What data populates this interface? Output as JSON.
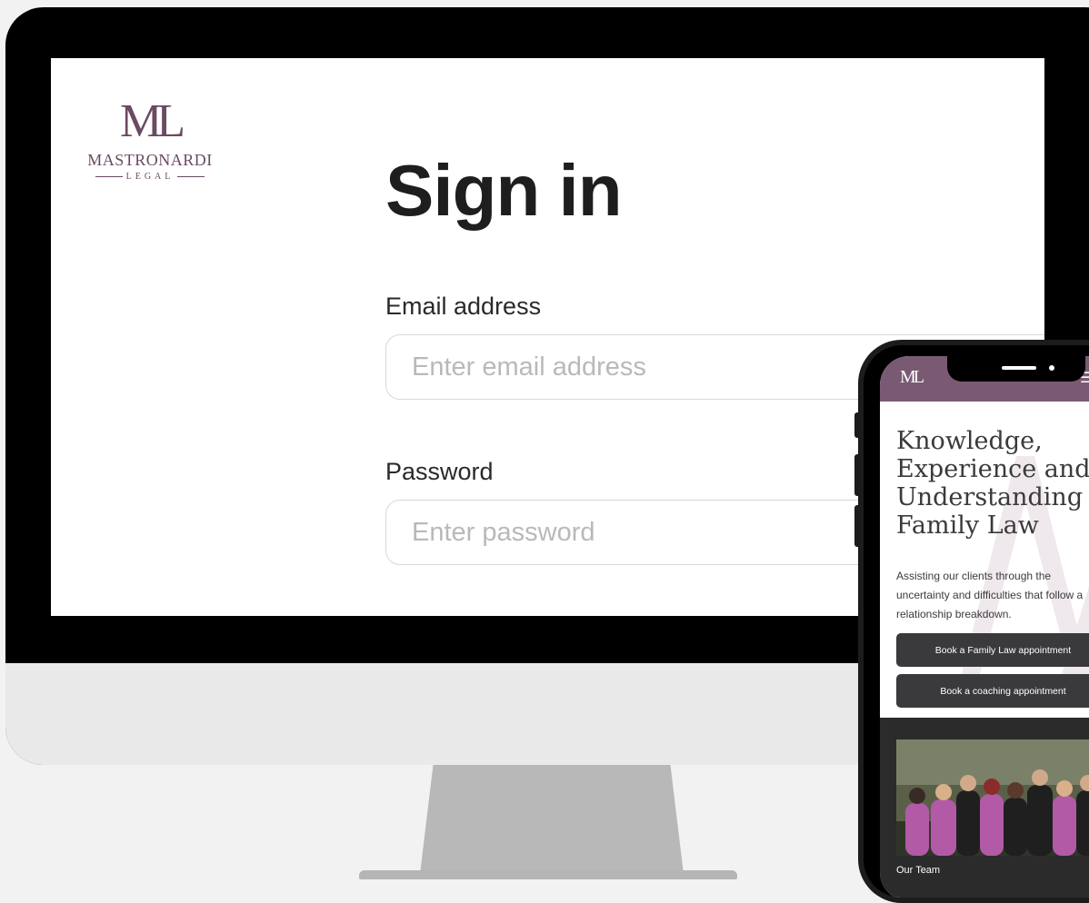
{
  "logo": {
    "mark": "ML",
    "name": "MASTRONARDI",
    "sub": "LEGAL"
  },
  "signin": {
    "title": "Sign in",
    "email_label": "Email address",
    "email_placeholder": "Enter email address",
    "password_label": "Password",
    "password_placeholder": "Enter password"
  },
  "phone": {
    "logo_mark": "ML",
    "menu_icon": "hamburger-menu-icon",
    "hero_title": "Knowledge, Experience and Understanding in Family Law",
    "hero_text": "Assisting our clients through the uncertainty and difficulties that follow a relationship breakdown.",
    "btn_family": "Book a Family Law appointment",
    "btn_coaching": "Book a coaching appointment",
    "team_caption": "Our Team"
  },
  "colors": {
    "brand": "#6b4a63",
    "phone_header": "#7a5a72",
    "button": "#3a3a3c",
    "team_shirt": "#b25aa6"
  }
}
